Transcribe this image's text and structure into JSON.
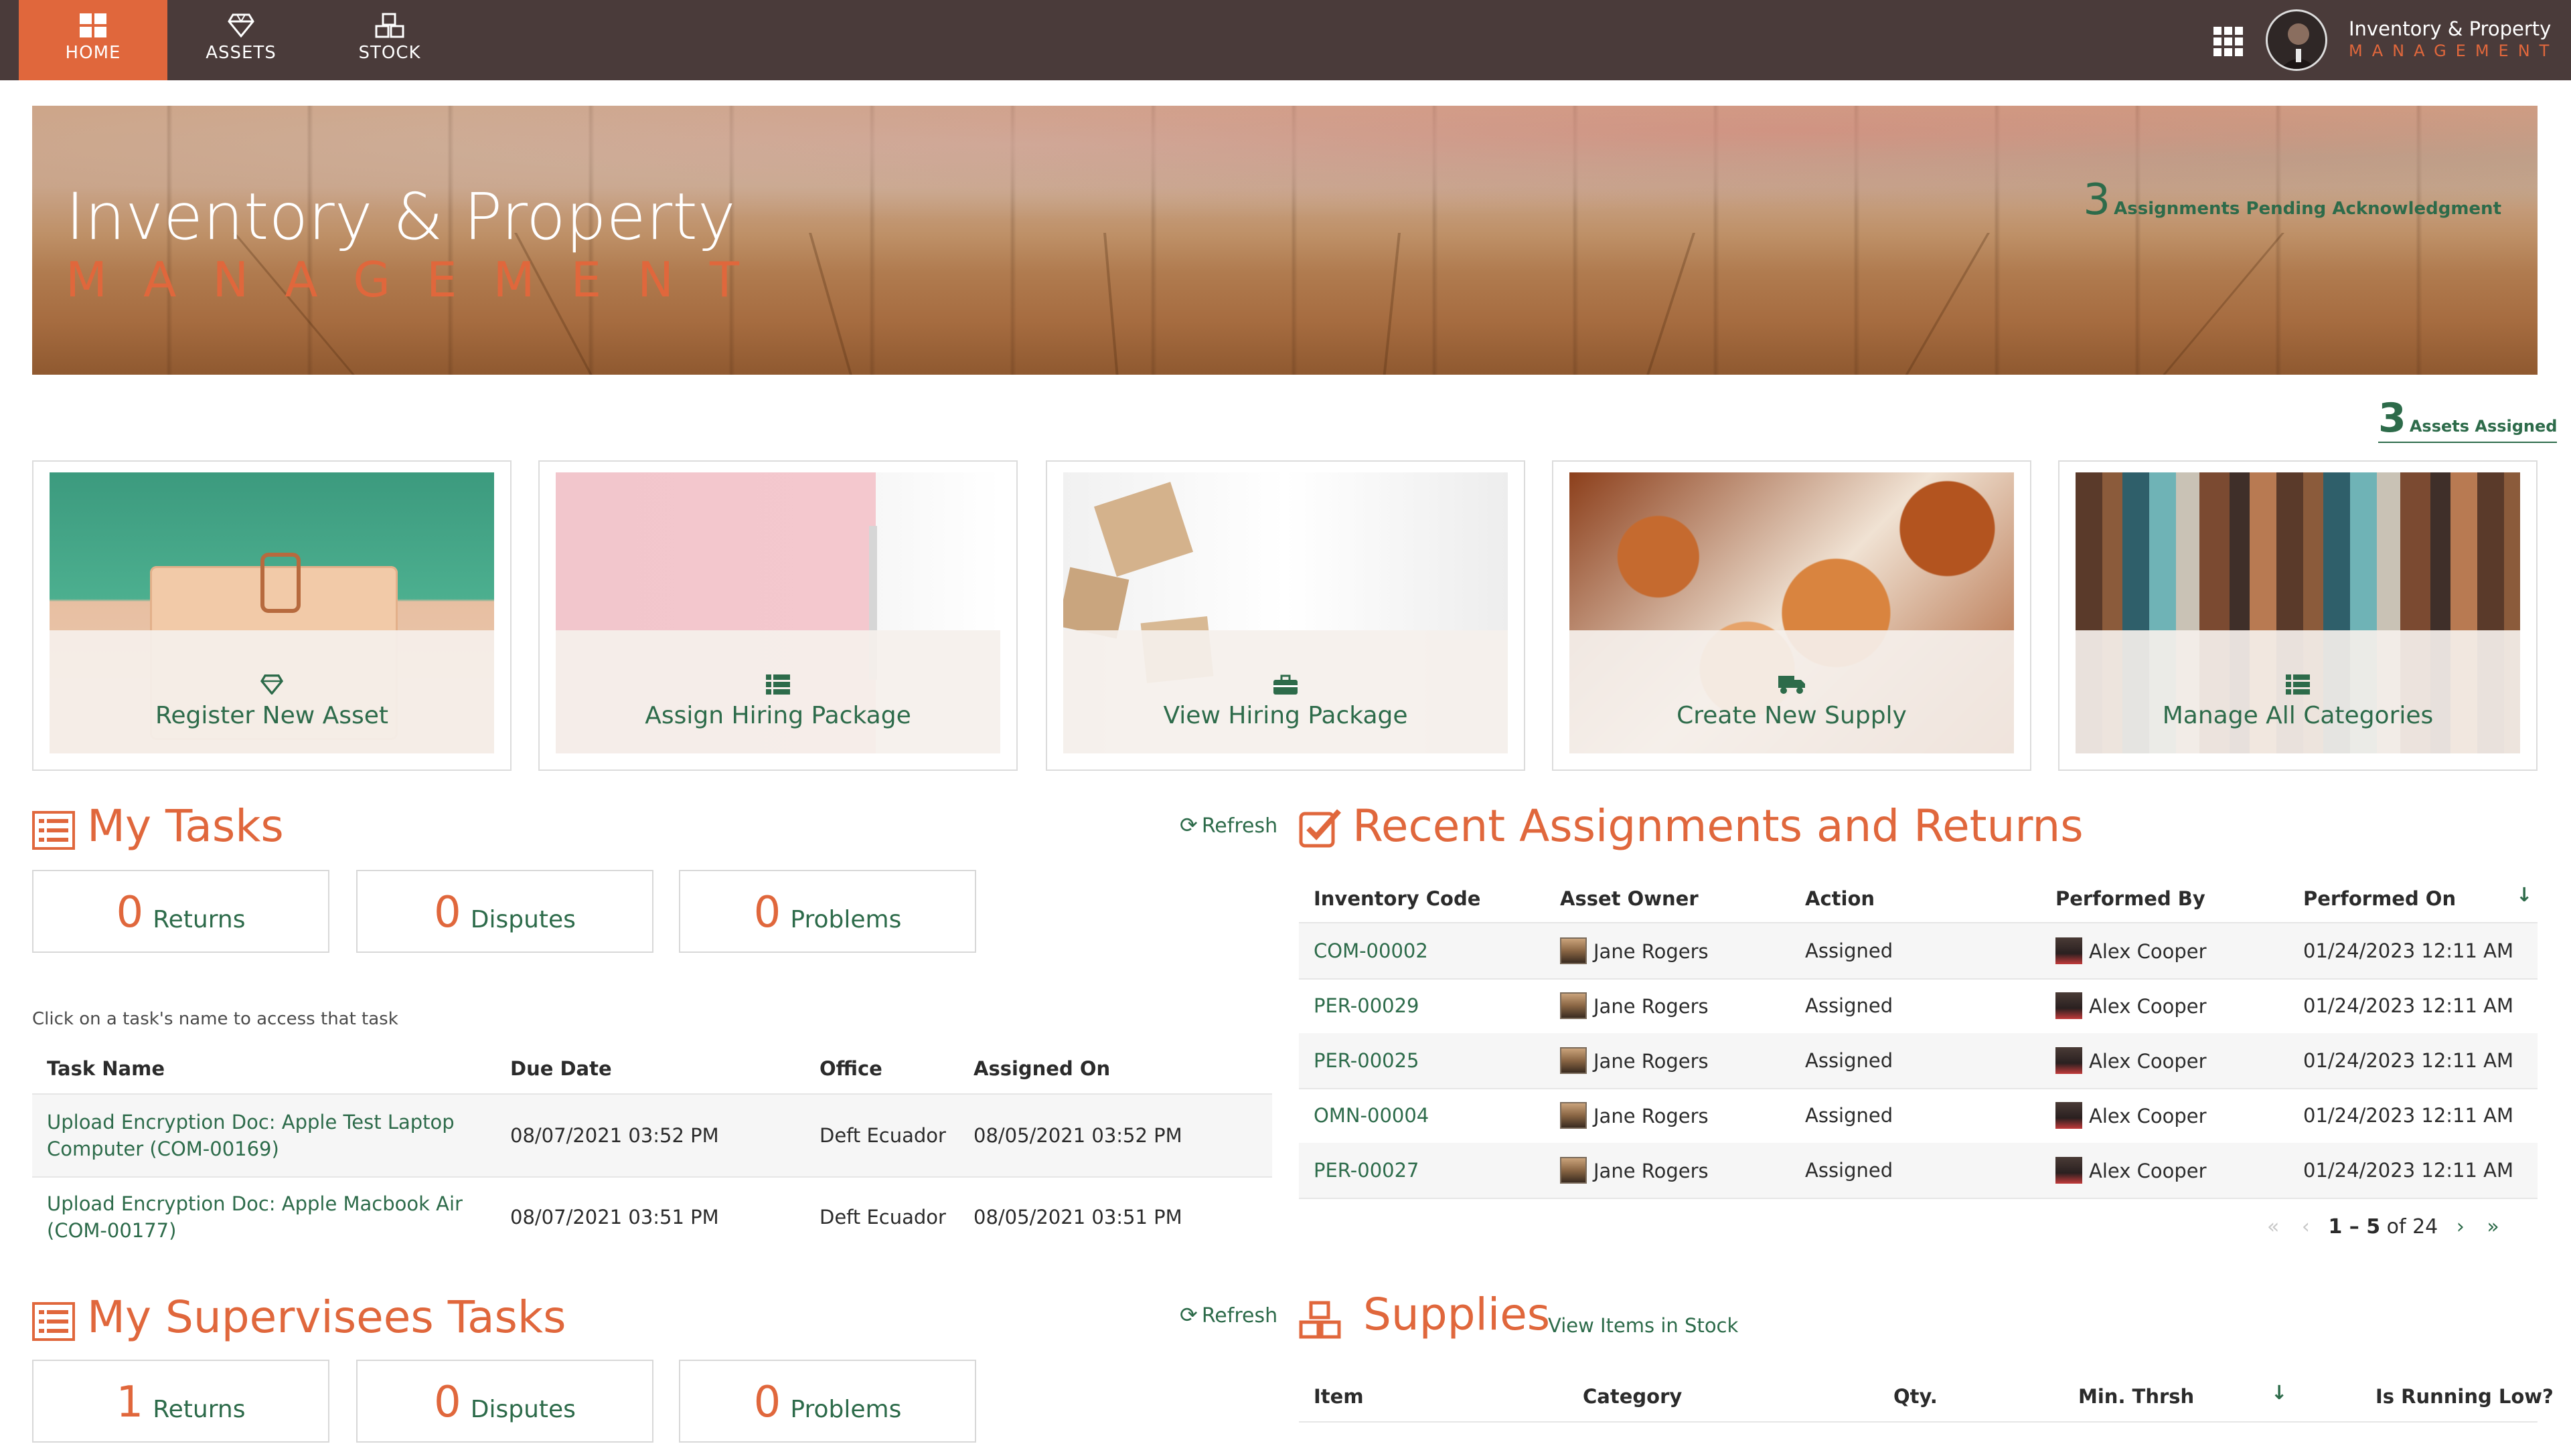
{
  "nav": {
    "home": "HOME",
    "assets": "ASSETS",
    "stock": "STOCK",
    "brand_line1": "Inventory & Property",
    "brand_line2": "MANAGEMENT"
  },
  "hero": {
    "title": "Inventory & Property",
    "subtitle": "MANAGEMENT",
    "pending_count": "3",
    "pending_text": "Assignments Pending Acknowledgment"
  },
  "assets_assigned": {
    "count": "3",
    "text": "Assets Assigned"
  },
  "actions": [
    {
      "label": "Register New Asset",
      "icon": "diamond-icon"
    },
    {
      "label": "Assign Hiring Package",
      "icon": "list-icon"
    },
    {
      "label": "View Hiring Package",
      "icon": "briefcase-icon"
    },
    {
      "label": "Create New Supply",
      "icon": "truck-icon"
    },
    {
      "label": "Manage All Categories",
      "icon": "list-icon"
    }
  ],
  "my_tasks": {
    "title": "My Tasks",
    "refresh": "Refresh",
    "counters": [
      {
        "value": "0",
        "label": "Returns"
      },
      {
        "value": "0",
        "label": "Disputes"
      },
      {
        "value": "0",
        "label": "Problems"
      }
    ],
    "hint": "Click on a task's name to access that task",
    "columns": [
      "Task Name",
      "Due Date",
      "Office",
      "Assigned On"
    ],
    "rows": [
      {
        "name_l1": "Upload Encryption Doc: Apple Test Laptop",
        "name_l2": "Computer (COM-00169)",
        "due": "08/07/2021 03:52 PM",
        "office": "Deft Ecuador",
        "assigned": "08/05/2021 03:52 PM"
      },
      {
        "name_l1": "Upload Encryption Doc: Apple Macbook Air",
        "name_l2": "(COM-00177)",
        "due": "08/07/2021 03:51 PM",
        "office": "Deft Ecuador",
        "assigned": "08/05/2021 03:51 PM"
      }
    ]
  },
  "supervisees": {
    "title": "My Supervisees Tasks",
    "refresh": "Refresh",
    "counters": [
      {
        "value": "1",
        "label": "Returns"
      },
      {
        "value": "0",
        "label": "Disputes"
      },
      {
        "value": "0",
        "label": "Problems"
      }
    ]
  },
  "recent": {
    "title": "Recent Assignments and Returns",
    "columns": [
      "Inventory Code",
      "Asset Owner",
      "Action",
      "Performed By",
      "Performed On"
    ],
    "rows": [
      {
        "code": "COM-00002",
        "owner": "Jane Rogers",
        "action": "Assigned",
        "by": "Alex Cooper",
        "on": "01/24/2023 12:11 AM"
      },
      {
        "code": "PER-00029",
        "owner": "Jane Rogers",
        "action": "Assigned",
        "by": "Alex Cooper",
        "on": "01/24/2023 12:11 AM"
      },
      {
        "code": "PER-00025",
        "owner": "Jane Rogers",
        "action": "Assigned",
        "by": "Alex Cooper",
        "on": "01/24/2023 12:11 AM"
      },
      {
        "code": "OMN-00004",
        "owner": "Jane Rogers",
        "action": "Assigned",
        "by": "Alex Cooper",
        "on": "01/24/2023 12:11 AM"
      },
      {
        "code": "PER-00027",
        "owner": "Jane Rogers",
        "action": "Assigned",
        "by": "Alex Cooper",
        "on": "01/24/2023 12:11 AM"
      }
    ],
    "pager": {
      "range": "1 – 5",
      "of": "of 24"
    }
  },
  "supplies": {
    "title": "Supplies",
    "link": "View Items in Stock",
    "columns": [
      "Item",
      "Category",
      "Qty.",
      "Min. Thrsh",
      "Is Running Low?"
    ]
  },
  "colors": {
    "accent": "#e0673c",
    "green": "#2d6b4a",
    "nav_bg": "#4a3b3a"
  }
}
